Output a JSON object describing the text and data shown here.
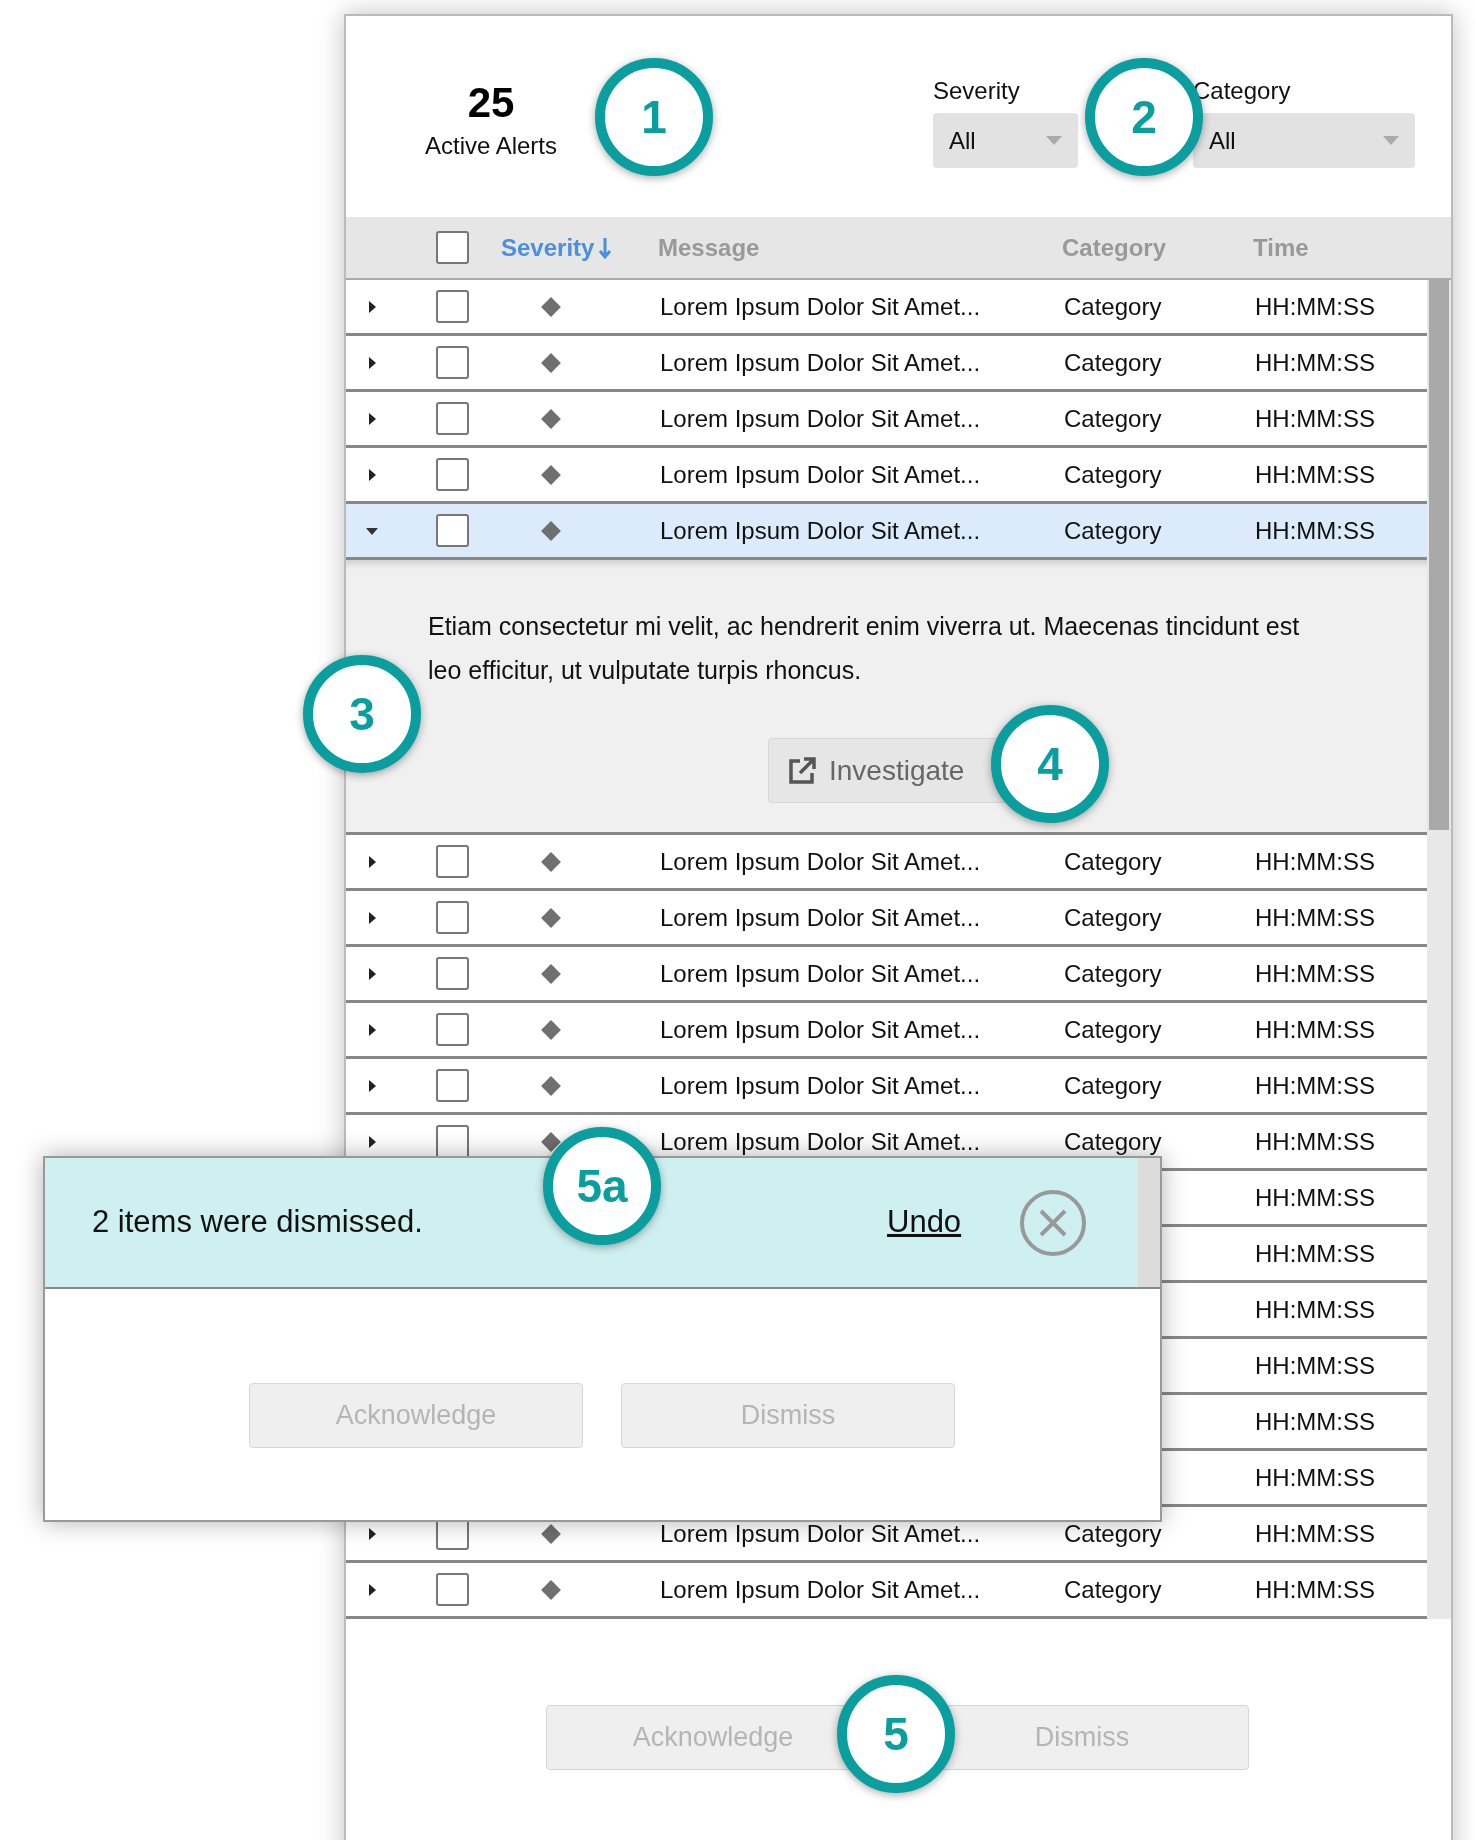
{
  "summary": {
    "count": "25",
    "label": "Active Alerts"
  },
  "filters": [
    {
      "label": "Severity",
      "value": "All"
    },
    {
      "label": "Category",
      "value": "All"
    }
  ],
  "table": {
    "header_checkbox": {
      "checked": false
    },
    "columns": [
      {
        "label": "Severity",
        "sorted": true
      },
      {
        "label": "Message",
        "sorted": false
      },
      {
        "label": "Category",
        "sorted": false
      },
      {
        "label": "Time",
        "sorted": false
      }
    ],
    "rows": [
      {
        "kind": "full",
        "expanded": false,
        "selected": false,
        "checked": false,
        "message": "Lorem Ipsum Dolor Sit Amet...",
        "category": "Category",
        "time": "HH:MM:SS"
      },
      {
        "kind": "full",
        "expanded": false,
        "selected": false,
        "checked": false,
        "message": "Lorem Ipsum Dolor Sit Amet...",
        "category": "Category",
        "time": "HH:MM:SS"
      },
      {
        "kind": "full",
        "expanded": false,
        "selected": false,
        "checked": false,
        "message": "Lorem Ipsum Dolor Sit Amet...",
        "category": "Category",
        "time": "HH:MM:SS"
      },
      {
        "kind": "full",
        "expanded": false,
        "selected": false,
        "checked": false,
        "message": "Lorem Ipsum Dolor Sit Amet...",
        "category": "Category",
        "time": "HH:MM:SS"
      },
      {
        "kind": "full",
        "expanded": true,
        "selected": true,
        "checked": false,
        "message": "Lorem Ipsum Dolor Sit Amet...",
        "category": "Category",
        "time": "HH:MM:SS",
        "detail": {
          "text": "Etiam consectetur mi velit, ac hendrerit enim viverra ut. Maecenas tincidunt est leo efficitur, ut vulputate turpis rhoncus.",
          "action": "Investigate"
        }
      },
      {
        "kind": "full",
        "expanded": false,
        "selected": false,
        "checked": false,
        "message": "Lorem Ipsum Dolor Sit Amet...",
        "category": "Category",
        "time": "HH:MM:SS"
      },
      {
        "kind": "full",
        "expanded": false,
        "selected": false,
        "checked": false,
        "message": "Lorem Ipsum Dolor Sit Amet...",
        "category": "Category",
        "time": "HH:MM:SS"
      },
      {
        "kind": "full",
        "expanded": false,
        "selected": false,
        "checked": false,
        "message": "Lorem Ipsum Dolor Sit Amet...",
        "category": "Category",
        "time": "HH:MM:SS"
      },
      {
        "kind": "full",
        "expanded": false,
        "selected": false,
        "checked": false,
        "message": "Lorem Ipsum Dolor Sit Amet...",
        "category": "Category",
        "time": "HH:MM:SS"
      },
      {
        "kind": "full",
        "expanded": false,
        "selected": false,
        "checked": false,
        "message": "Lorem Ipsum Dolor Sit Amet...",
        "category": "Category",
        "time": "HH:MM:SS"
      },
      {
        "kind": "full",
        "expanded": false,
        "selected": false,
        "checked": false,
        "message": "Lorem Ipsum Dolor Sit Amet...",
        "category": "Category",
        "time": "HH:MM:SS"
      },
      {
        "kind": "partial",
        "selected": false,
        "time": "HH:MM:SS"
      },
      {
        "kind": "partial",
        "selected": false,
        "time": "HH:MM:SS"
      },
      {
        "kind": "partial",
        "selected": false,
        "time": "HH:MM:SS"
      },
      {
        "kind": "partial",
        "selected": false,
        "time": "HH:MM:SS"
      },
      {
        "kind": "partial",
        "selected": false,
        "time": "HH:MM:SS"
      },
      {
        "kind": "partial",
        "selected": false,
        "time": "HH:MM:SS"
      },
      {
        "kind": "full",
        "expanded": false,
        "selected": false,
        "checked": false,
        "message": "Lorem Ipsum Dolor Sit Amet...",
        "category": "Category",
        "time": "HH:MM:SS"
      },
      {
        "kind": "full",
        "expanded": false,
        "selected": false,
        "checked": false,
        "message": "Lorem Ipsum Dolor Sit Amet...",
        "category": "Category",
        "time": "HH:MM:SS"
      }
    ]
  },
  "footer_buttons": [
    {
      "label": "Acknowledge",
      "disabled": true
    },
    {
      "label": "Dismiss",
      "disabled": true
    }
  ],
  "toast": {
    "message": "2 items were dismissed.",
    "action": "Undo",
    "buttons": [
      {
        "label": "Acknowledge",
        "disabled": true
      },
      {
        "label": "Dismiss",
        "disabled": true
      }
    ]
  },
  "callouts": [
    {
      "label": "1"
    },
    {
      "label": "2"
    },
    {
      "label": "3"
    },
    {
      "label": "4"
    },
    {
      "label": "5a"
    },
    {
      "label": "5"
    }
  ]
}
